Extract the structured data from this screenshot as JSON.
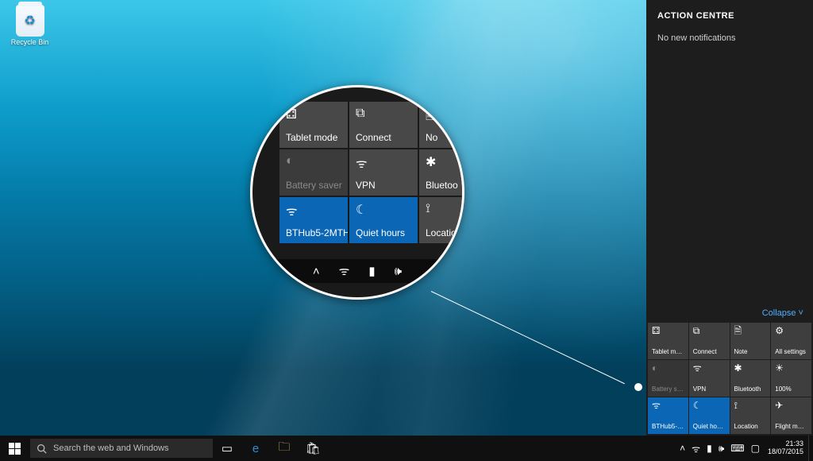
{
  "desktop": {
    "recycle_bin_label": "Recycle Bin"
  },
  "action_centre": {
    "title": "ACTION CENTRE",
    "no_notifications": "No new notifications",
    "collapse_label": "Collapse ˅",
    "tiles": [
      {
        "icon": "⚃",
        "label": "Tablet mode",
        "state": "normal"
      },
      {
        "icon": "⧉",
        "label": "Connect",
        "state": "normal"
      },
      {
        "icon": "🗎",
        "label": "Note",
        "state": "normal"
      },
      {
        "icon": "⚙",
        "label": "All settings",
        "state": "normal"
      },
      {
        "icon": "◐",
        "label": "Battery saver",
        "state": "dim"
      },
      {
        "icon": "ᯤ",
        "label": "VPN",
        "state": "normal"
      },
      {
        "icon": "✱",
        "label": "Bluetooth",
        "state": "normal"
      },
      {
        "icon": "☀",
        "label": "100%",
        "state": "normal"
      },
      {
        "icon": "ᯤ",
        "label": "BTHub5-2MTH",
        "state": "on"
      },
      {
        "icon": "☾",
        "label": "Quiet hours",
        "state": "on"
      },
      {
        "icon": "⟟",
        "label": "Location",
        "state": "normal"
      },
      {
        "icon": "✈",
        "label": "Flight mode",
        "state": "normal"
      }
    ]
  },
  "magnifier": {
    "tiles": [
      {
        "icon": "⚃",
        "label": "Tablet mode",
        "state": "normal"
      },
      {
        "icon": "⧉",
        "label": "Connect",
        "state": "normal"
      },
      {
        "icon": "🗎",
        "label": "No",
        "state": "normal"
      },
      {
        "icon": "◐",
        "label": "Battery saver",
        "state": "dim"
      },
      {
        "icon": "ᯤ",
        "label": "VPN",
        "state": "normal"
      },
      {
        "icon": "✱",
        "label": "Bluetoo",
        "state": "normal"
      },
      {
        "icon": "ᯤ",
        "label": "BTHub5-2MTH",
        "state": "on"
      },
      {
        "icon": "☾",
        "label": "Quiet hours",
        "state": "on"
      },
      {
        "icon": "⟟",
        "label": "Locatio",
        "state": "normal"
      }
    ],
    "tray_icons": [
      "˄",
      "ᯤ",
      "▮",
      "🕪"
    ]
  },
  "taskbar": {
    "search_placeholder": "Search the web and Windows",
    "clock_time": "21:33",
    "clock_date": "18/07/2015"
  }
}
